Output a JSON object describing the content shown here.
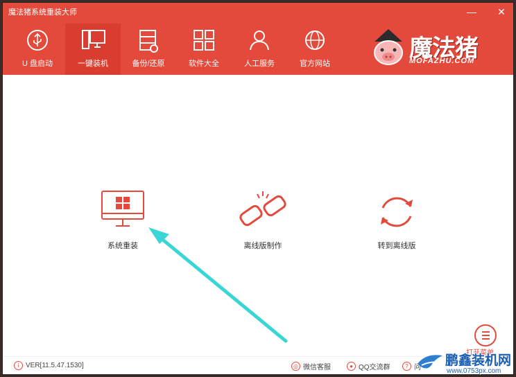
{
  "window": {
    "title": "魔法猪系统重装大师",
    "min_icon": "minimize-icon",
    "close_icon": "close-icon"
  },
  "nav": [
    {
      "label": "U 盘启动",
      "icon": "usb-icon"
    },
    {
      "label": "一键装机",
      "icon": "monitor-icon",
      "active": true
    },
    {
      "label": "备份/还原",
      "icon": "backup-icon"
    },
    {
      "label": "软件大全",
      "icon": "apps-grid-icon"
    },
    {
      "label": "人工服务",
      "icon": "user-service-icon"
    },
    {
      "label": "官方网站",
      "icon": "globe-icon"
    }
  ],
  "brand": {
    "name": "魔法猪",
    "sub": "MOFAZHU.COM"
  },
  "actions": {
    "reinstall": "系统重装",
    "offline": "离线版制作",
    "switch": "转到离线版"
  },
  "footer": {
    "version": "VER[11.5.47.1530]",
    "wechat": "微信客服",
    "qq": "QQ交流群",
    "faq": "问",
    "menu_label": "打开菜单"
  },
  "watermark": {
    "name": "鹏鑫装机网",
    "url": "www.0753px.com"
  },
  "colors": {
    "accent": "#e44a3c",
    "arrow": "#3ad6d6"
  }
}
